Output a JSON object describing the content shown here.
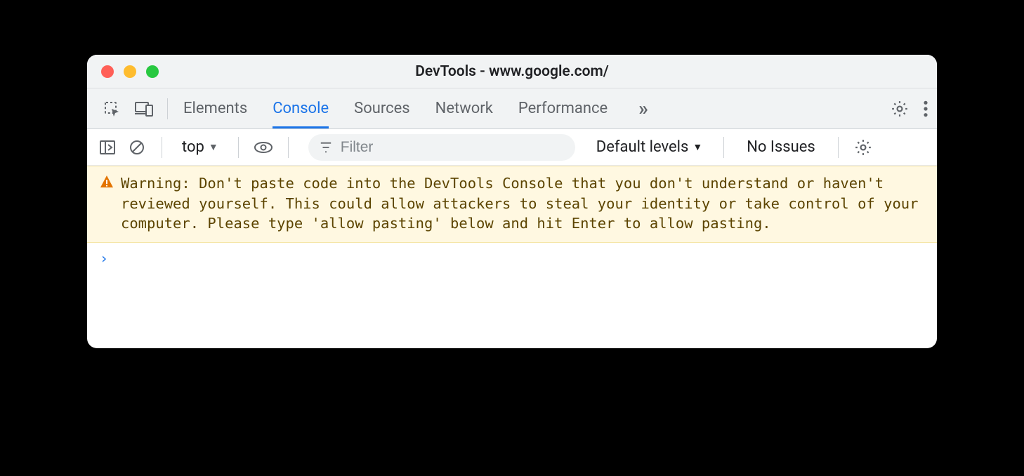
{
  "window": {
    "title": "DevTools - www.google.com/"
  },
  "tabs": {
    "items": [
      {
        "label": "Elements"
      },
      {
        "label": "Console"
      },
      {
        "label": "Sources"
      },
      {
        "label": "Network"
      },
      {
        "label": "Performance"
      }
    ],
    "active_index": 1,
    "overflow_glyph": "»"
  },
  "toolbar": {
    "context_label": "top",
    "filter_placeholder": "Filter",
    "levels_label": "Default levels",
    "issues_label": "No Issues"
  },
  "console": {
    "warning": {
      "label": "Warning:",
      "text": "Don't paste code into the DevTools Console that you don't understand or haven't reviewed yourself. This could allow attackers to steal your identity or take control of your computer. Please type 'allow pasting' below and hit Enter to allow pasting."
    },
    "prompt_glyph": "›"
  }
}
